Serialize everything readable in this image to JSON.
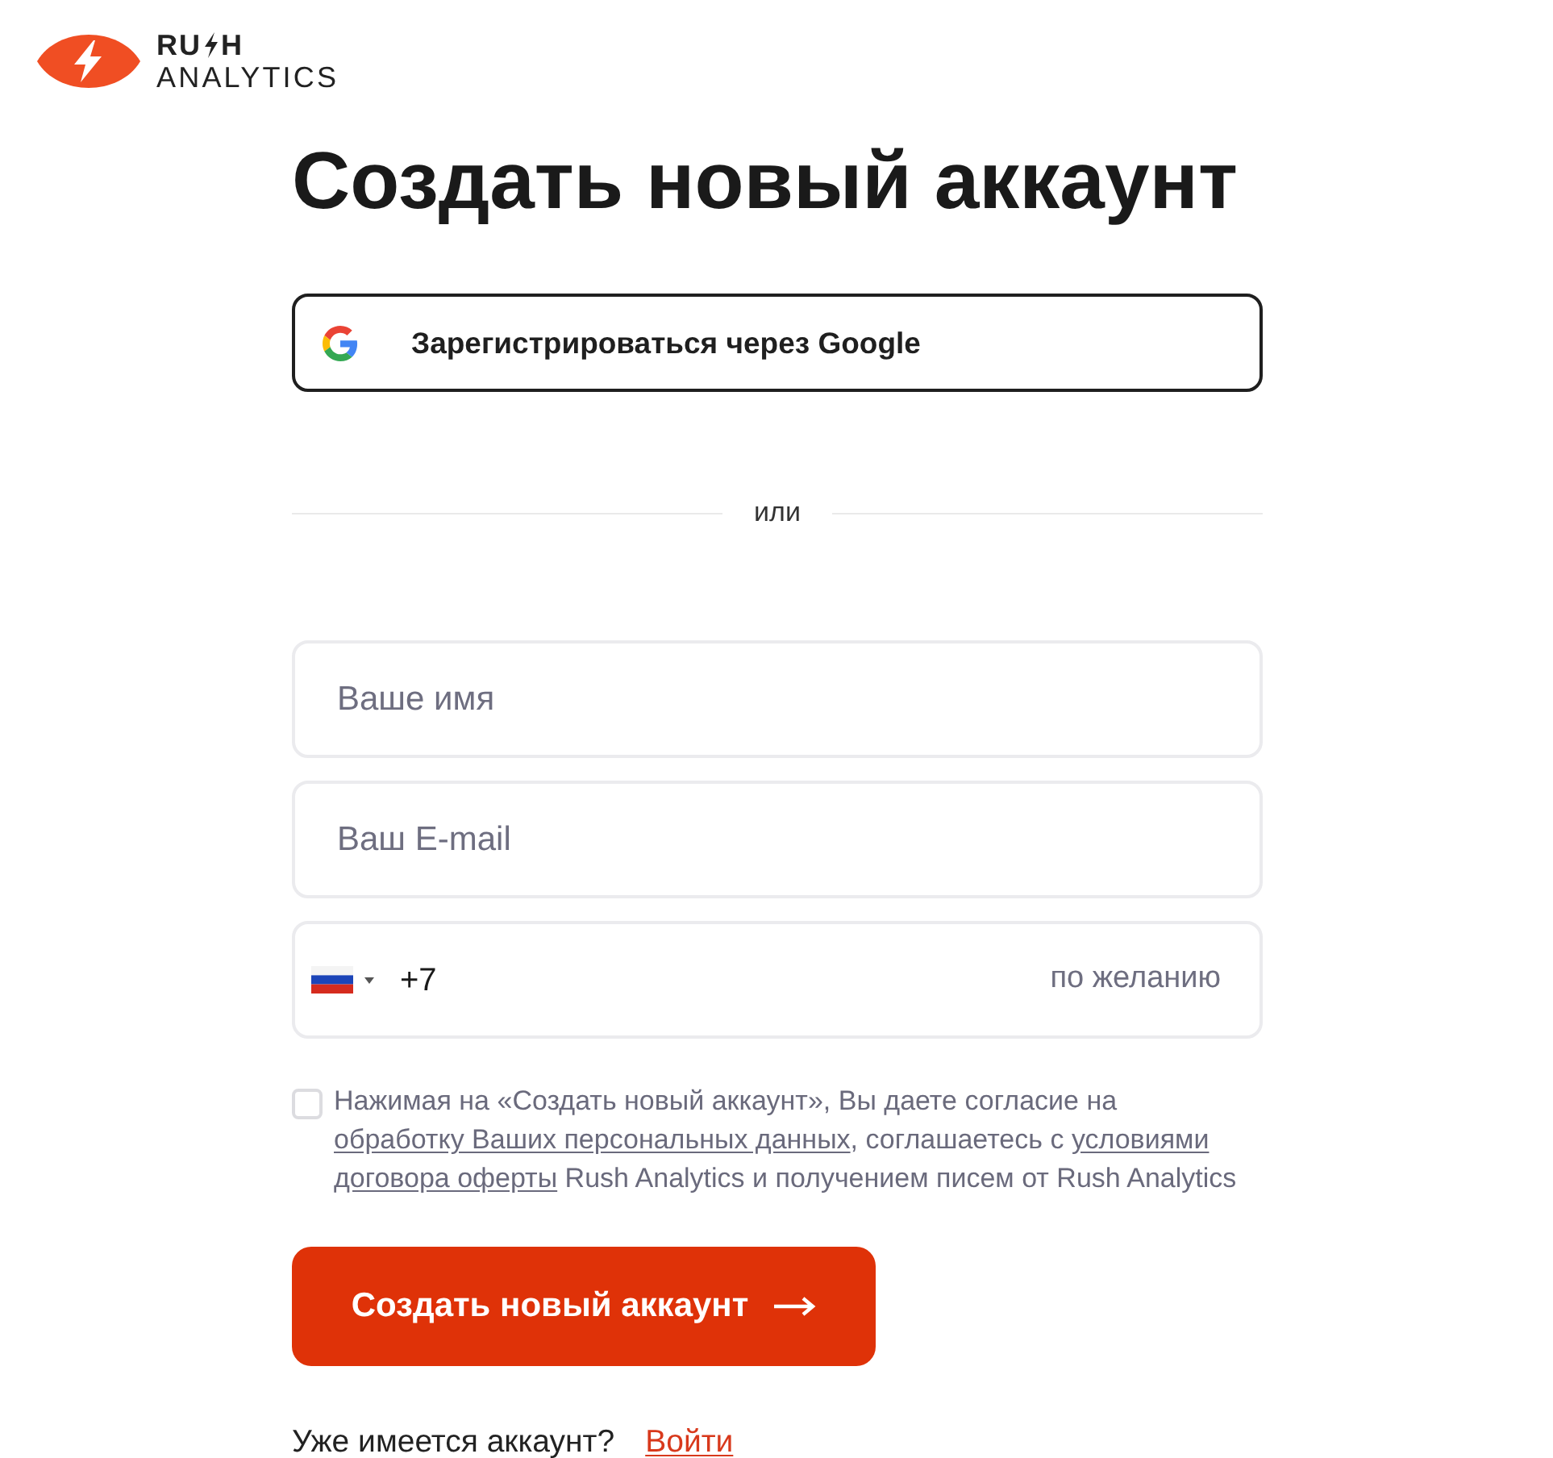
{
  "logo": {
    "word_start": "RU",
    "word_end": "H",
    "subtitle": "ANALYTICS"
  },
  "title": "Создать новый аккаунт",
  "google_button": {
    "label": "Зарегистрироваться через Google"
  },
  "divider": {
    "label": "или"
  },
  "fields": [
    {
      "kind": "text",
      "placeholder": "Ваше имя"
    },
    {
      "kind": "text",
      "placeholder": "Ваш E-mail"
    },
    {
      "kind": "phone",
      "value": "+7",
      "hint": "по желанию"
    }
  ],
  "consent": {
    "checked": false,
    "parts": [
      {
        "kind": "text",
        "text": "Нажимая на «Создать новый аккаунт», Вы даете согласие на "
      },
      {
        "kind": "link",
        "text": "обработку Ваших персональных данных"
      },
      {
        "kind": "text",
        "text": ", соглашаетесь с "
      },
      {
        "kind": "link",
        "text": "условиями"
      },
      {
        "kind": "link",
        "text": "договора оферты"
      },
      {
        "kind": "text",
        "text": " Rush Analytics и получением писем от Rush Analytics"
      }
    ]
  },
  "submit_button": {
    "label": "Создать новый аккаунт"
  },
  "login": {
    "question": "Уже имеется аккаунт?",
    "link": "Войти"
  }
}
